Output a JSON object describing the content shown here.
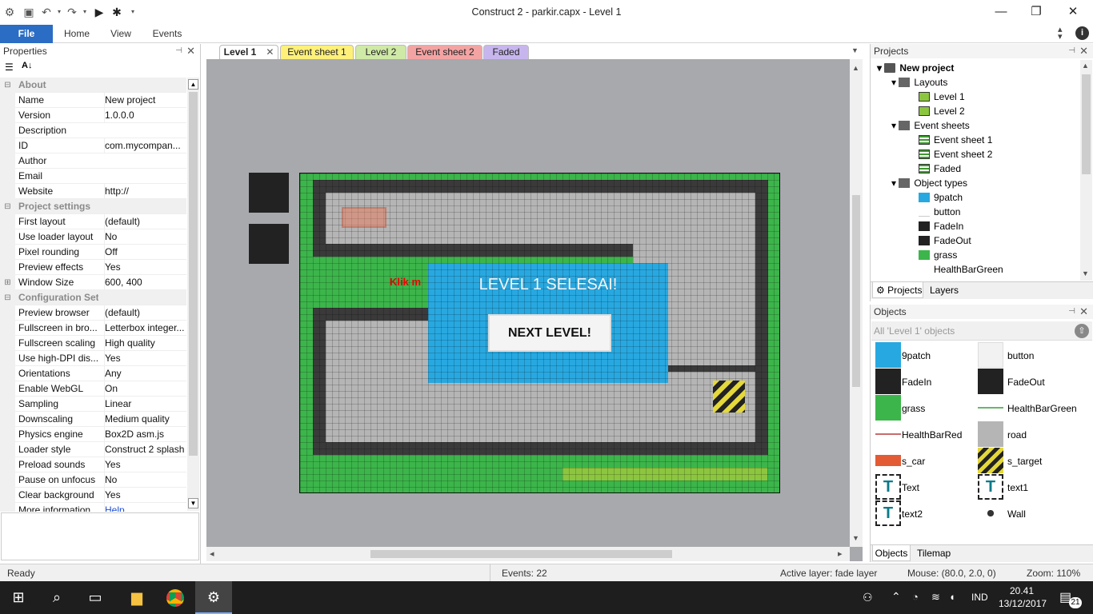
{
  "window": {
    "title": "Construct 2 - parkir.capx - Level 1"
  },
  "ribbon": {
    "file": "File",
    "home": "Home",
    "view": "View",
    "events": "Events"
  },
  "properties": {
    "title": "Properties",
    "rows": [
      {
        "type": "cat",
        "key": "About"
      },
      {
        "type": "row",
        "key": "Name",
        "value": "New project"
      },
      {
        "type": "row",
        "key": "Version",
        "value": "1.0.0.0"
      },
      {
        "type": "row",
        "key": "Description",
        "value": ""
      },
      {
        "type": "row",
        "key": "ID",
        "value": "com.mycompan..."
      },
      {
        "type": "row",
        "key": "Author",
        "value": ""
      },
      {
        "type": "row",
        "key": "Email",
        "value": ""
      },
      {
        "type": "row",
        "key": "Website",
        "value": "http://"
      },
      {
        "type": "cat",
        "key": "Project settings"
      },
      {
        "type": "row",
        "key": "First layout",
        "value": "(default)"
      },
      {
        "type": "row",
        "key": "Use loader layout",
        "value": "No"
      },
      {
        "type": "row",
        "key": "Pixel rounding",
        "value": "Off"
      },
      {
        "type": "row",
        "key": "Preview effects",
        "value": "Yes"
      },
      {
        "type": "row",
        "key": "Window Size",
        "value": "600, 400",
        "expand": true
      },
      {
        "type": "cat",
        "key": "Configuration Settings"
      },
      {
        "type": "row",
        "key": "Preview browser",
        "value": "(default)"
      },
      {
        "type": "row",
        "key": "Fullscreen in bro...",
        "value": "Letterbox integer..."
      },
      {
        "type": "row",
        "key": "Fullscreen scaling",
        "value": "High quality"
      },
      {
        "type": "row",
        "key": "Use high-DPI dis...",
        "value": "Yes"
      },
      {
        "type": "row",
        "key": "Orientations",
        "value": "Any"
      },
      {
        "type": "row",
        "key": "Enable WebGL",
        "value": "On"
      },
      {
        "type": "row",
        "key": "Sampling",
        "value": "Linear"
      },
      {
        "type": "row",
        "key": "Downscaling",
        "value": "Medium quality"
      },
      {
        "type": "row",
        "key": "Physics engine",
        "value": "Box2D asm.js"
      },
      {
        "type": "row",
        "key": "Loader style",
        "value": "Construct 2 splash"
      },
      {
        "type": "row",
        "key": "Preload sounds",
        "value": "Yes"
      },
      {
        "type": "row",
        "key": "Pause on unfocus",
        "value": "No"
      },
      {
        "type": "row",
        "key": "Clear background",
        "value": "Yes"
      },
      {
        "type": "row",
        "key": "More information",
        "value": "Help"
      }
    ]
  },
  "doc_tabs": [
    "Level 1",
    "Event sheet 1",
    "Level 2",
    "Event sheet 2",
    "Faded"
  ],
  "layout": {
    "popup_title": "LEVEL 1 SELESAI!",
    "next_button": "NEXT LEVEL!",
    "hint_text": "Klik m"
  },
  "projects": {
    "title": "Projects",
    "root": "New project",
    "folders": {
      "layouts": "Layouts",
      "event_sheets": "Event sheets",
      "object_types": "Object types"
    },
    "layouts": [
      "Level 1",
      "Level 2"
    ],
    "event_sheets": [
      "Event sheet 1",
      "Event sheet 2",
      "Faded"
    ],
    "object_types": [
      "9patch",
      "button",
      "FadeIn",
      "FadeOut",
      "grass",
      "HealthBarGreen"
    ],
    "tabs": [
      "Projects",
      "Layers"
    ]
  },
  "objects": {
    "title": "Objects",
    "filter": "All 'Level 1' objects",
    "items": [
      "9patch",
      "button",
      "FadeIn",
      "FadeOut",
      "grass",
      "HealthBarGreen",
      "HealthBarRed",
      "road",
      "s_car",
      "s_target",
      "Text",
      "text1",
      "text2",
      "Wall"
    ],
    "tabs": [
      "Objects",
      "Tilemap"
    ]
  },
  "status": {
    "ready": "Ready",
    "events": "Events: 22",
    "active_layer": "Active layer: fade layer",
    "mouse": "Mouse: (80.0, 2.0, 0)",
    "zoom": "Zoom: 110%"
  },
  "taskbar": {
    "language": "IND",
    "time": "20.41",
    "date": "13/12/2017",
    "notifications": "21"
  },
  "colors": {
    "file_tab": "#2b6cc4",
    "grass": "#3cb54a",
    "road": "#b5b5b5",
    "wall": "#3a3a3a",
    "popup": "#28a8e0",
    "level1_tab": "#dfe9f7",
    "eventsheet1_tab": "#fff07a",
    "level2_tab": "#cfe9a6",
    "eventsheet2_tab": "#f4a3a3",
    "faded_tab": "#c7b6ee"
  }
}
